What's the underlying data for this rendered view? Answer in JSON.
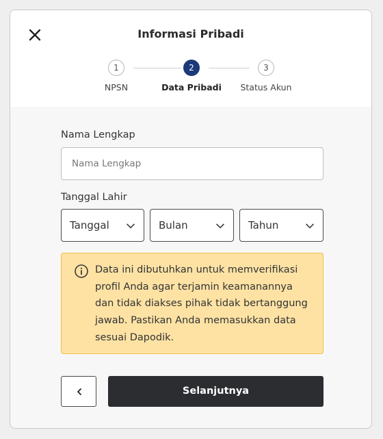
{
  "header": {
    "title": "Informasi Pribadi"
  },
  "stepper": {
    "steps": [
      {
        "number": "1",
        "label": "NPSN",
        "state": "inactive"
      },
      {
        "number": "2",
        "label": "Data Pribadi",
        "state": "active"
      },
      {
        "number": "3",
        "label": "Status Akun",
        "state": "inactive"
      }
    ]
  },
  "form": {
    "name": {
      "label": "Nama Lengkap",
      "placeholder": "Nama Lengkap",
      "value": ""
    },
    "birthdate": {
      "label": "Tanggal Lahir",
      "day": "Tanggal",
      "month": "Bulan",
      "year": "Tahun"
    }
  },
  "alert": {
    "icon": "info-circle-icon",
    "text": "Data ini dibutuhkan untuk memverifikasi profil Anda agar terjamin keamanannya dan tidak diakses pihak tidak bertanggung jawab. Pastikan Anda memasukkan data sesuai Dapodik."
  },
  "footer": {
    "back_icon": "chevron-left-icon",
    "next_label": "Selanjutnya"
  },
  "colors": {
    "active_step": "#1c3a7a",
    "alert_bg": "#fde2a4",
    "alert_border": "#f1c04a",
    "primary_button": "#2c2d30"
  }
}
